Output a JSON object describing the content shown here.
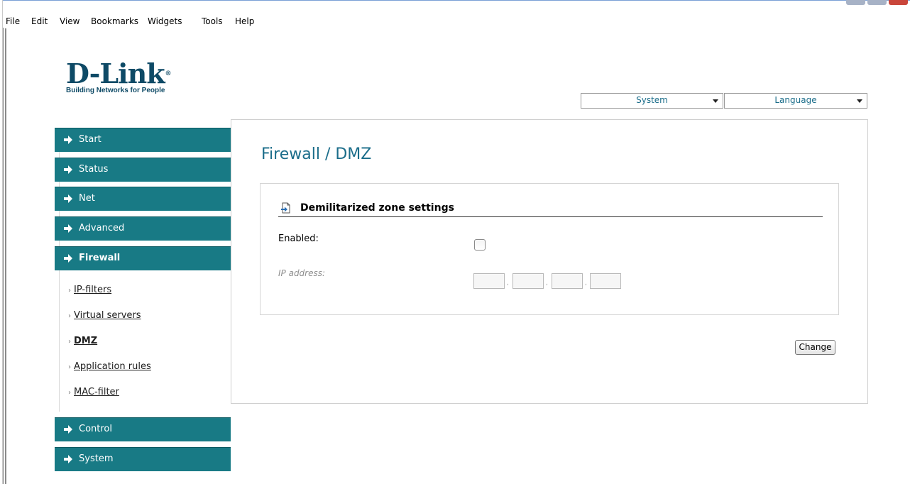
{
  "menubar": {
    "items": [
      "File",
      "Edit",
      "View",
      "Bookmarks",
      "Widgets",
      "Tools",
      "Help"
    ]
  },
  "header": {
    "brand": "D-Link",
    "reg_mark": "®",
    "tagline": "Building Networks for People",
    "system_select": "System",
    "language_select": "Language"
  },
  "sidebar": {
    "items": [
      {
        "label": "Start"
      },
      {
        "label": "Status"
      },
      {
        "label": "Net"
      },
      {
        "label": "Advanced"
      },
      {
        "label": "Firewall"
      },
      {
        "label": "Control"
      },
      {
        "label": "System"
      }
    ],
    "firewall_sub": [
      {
        "label": "IP-filters"
      },
      {
        "label": "Virtual servers"
      },
      {
        "label": "DMZ"
      },
      {
        "label": "Application rules"
      },
      {
        "label": "MAC-filter"
      }
    ]
  },
  "main": {
    "title": "Firewall / DMZ",
    "section_title": "Demilitarized zone settings",
    "enabled_label": "Enabled:",
    "ip_label": "IP address:",
    "ip_octets": [
      "",
      "",
      "",
      ""
    ],
    "change_button": "Change"
  },
  "colors": {
    "nav_bg": "#187a85",
    "title": "#1b6d8a",
    "brand": "#0e4a66"
  }
}
